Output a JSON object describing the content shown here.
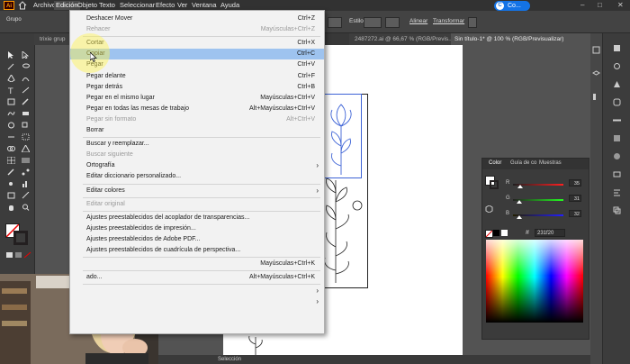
{
  "app": {
    "logo": "Ai"
  },
  "menubar": {
    "items": [
      "Archivo",
      "Edición",
      "Objeto",
      "Texto",
      "Seleccionar",
      "Efecto",
      "Ver",
      "Ventana",
      "Ayuda"
    ],
    "user": "Co..."
  },
  "controlbar": {
    "left_label": "Grupo",
    "estilo_label": "Estilo:",
    "alinear": "Alinear",
    "transformar": "Transformar"
  },
  "tabs": [
    "trixie grup",
    "2487272.ai @ 66,67 % (RGB/Previs...",
    "Sin título-1* @ 100 % (RGB/Previsualizar)"
  ],
  "edit_menu": {
    "items": [
      {
        "label": "Deshacer Mover",
        "shortcut": "Ctrl+Z",
        "disabled": false
      },
      {
        "label": "Rehacer",
        "shortcut": "Mayúsculas+Ctrl+Z",
        "disabled": true
      },
      {
        "sep": true
      },
      {
        "label": "Cortar",
        "shortcut": "Ctrl+X",
        "disabled": false
      },
      {
        "label": "Copiar",
        "shortcut": "Ctrl+C",
        "disabled": false,
        "highlighted": true
      },
      {
        "label": "Pegar",
        "shortcut": "Ctrl+V",
        "disabled": false
      },
      {
        "label": "Pegar delante",
        "shortcut": "Ctrl+F",
        "disabled": false
      },
      {
        "label": "Pegar detrás",
        "shortcut": "Ctrl+B",
        "disabled": false
      },
      {
        "label": "Pegar en el mismo lugar",
        "shortcut": "Mayúsculas+Ctrl+V",
        "disabled": false
      },
      {
        "label": "Pegar en todas las mesas de trabajo",
        "shortcut": "Alt+Mayúsculas+Ctrl+V",
        "disabled": false
      },
      {
        "label": "Pegar sin formato",
        "shortcut": "Alt+Ctrl+V",
        "disabled": true
      },
      {
        "label": "Borrar",
        "shortcut": "",
        "disabled": false
      },
      {
        "sep": true
      },
      {
        "label": "Buscar y reemplazar...",
        "shortcut": "",
        "disabled": false
      },
      {
        "label": "Buscar siguiente",
        "shortcut": "",
        "disabled": true
      },
      {
        "label": "Ortografía",
        "shortcut": "",
        "disabled": false,
        "submenu": true
      },
      {
        "label": "Editar diccionario personalizado...",
        "shortcut": "",
        "disabled": false
      },
      {
        "sep": true
      },
      {
        "label": "Editar colores",
        "shortcut": "",
        "disabled": false,
        "submenu": true
      },
      {
        "sep": true
      },
      {
        "label": "Editar original",
        "shortcut": "",
        "disabled": true
      },
      {
        "sep": true
      },
      {
        "label": "Ajustes preestablecidos del acoplador de transparencias...",
        "shortcut": "",
        "disabled": false
      },
      {
        "label": "Ajustes preestablecidos de impresión...",
        "shortcut": "",
        "disabled": false
      },
      {
        "label": "Ajustes preestablecidos de Adobe PDF...",
        "shortcut": "",
        "disabled": false
      },
      {
        "label": "Ajustes preestablecidos de cuadrícula de perspectiva...",
        "shortcut": "",
        "disabled": false
      },
      {
        "sep": true
      },
      {
        "label": "",
        "shortcut": "Mayúsculas+Ctrl+K",
        "disabled": false
      },
      {
        "sep": true
      },
      {
        "label": "ado...",
        "shortcut": "Alt+Mayúsculas+Ctrl+K",
        "disabled": false
      },
      {
        "sep": true
      },
      {
        "label": "",
        "shortcut": "",
        "disabled": false,
        "submenu": true
      },
      {
        "label": "",
        "shortcut": "",
        "disabled": false,
        "submenu": true
      }
    ]
  },
  "color_panel": {
    "tabs": [
      "Color",
      "Guía de co",
      "Muestras"
    ],
    "r_label": "R",
    "g_label": "G",
    "b_label": "B",
    "r": "35",
    "g": "31",
    "b": "32",
    "r_fraction": 0.14,
    "g_fraction": 0.12,
    "b_fraction": 0.13,
    "hex": "231f20"
  },
  "status": {
    "mode": "Selección"
  },
  "colors": {
    "menu_highlight": "#9ec3ef",
    "accent_blue": "#1473e6",
    "selection_blue": "#3d63d6"
  }
}
